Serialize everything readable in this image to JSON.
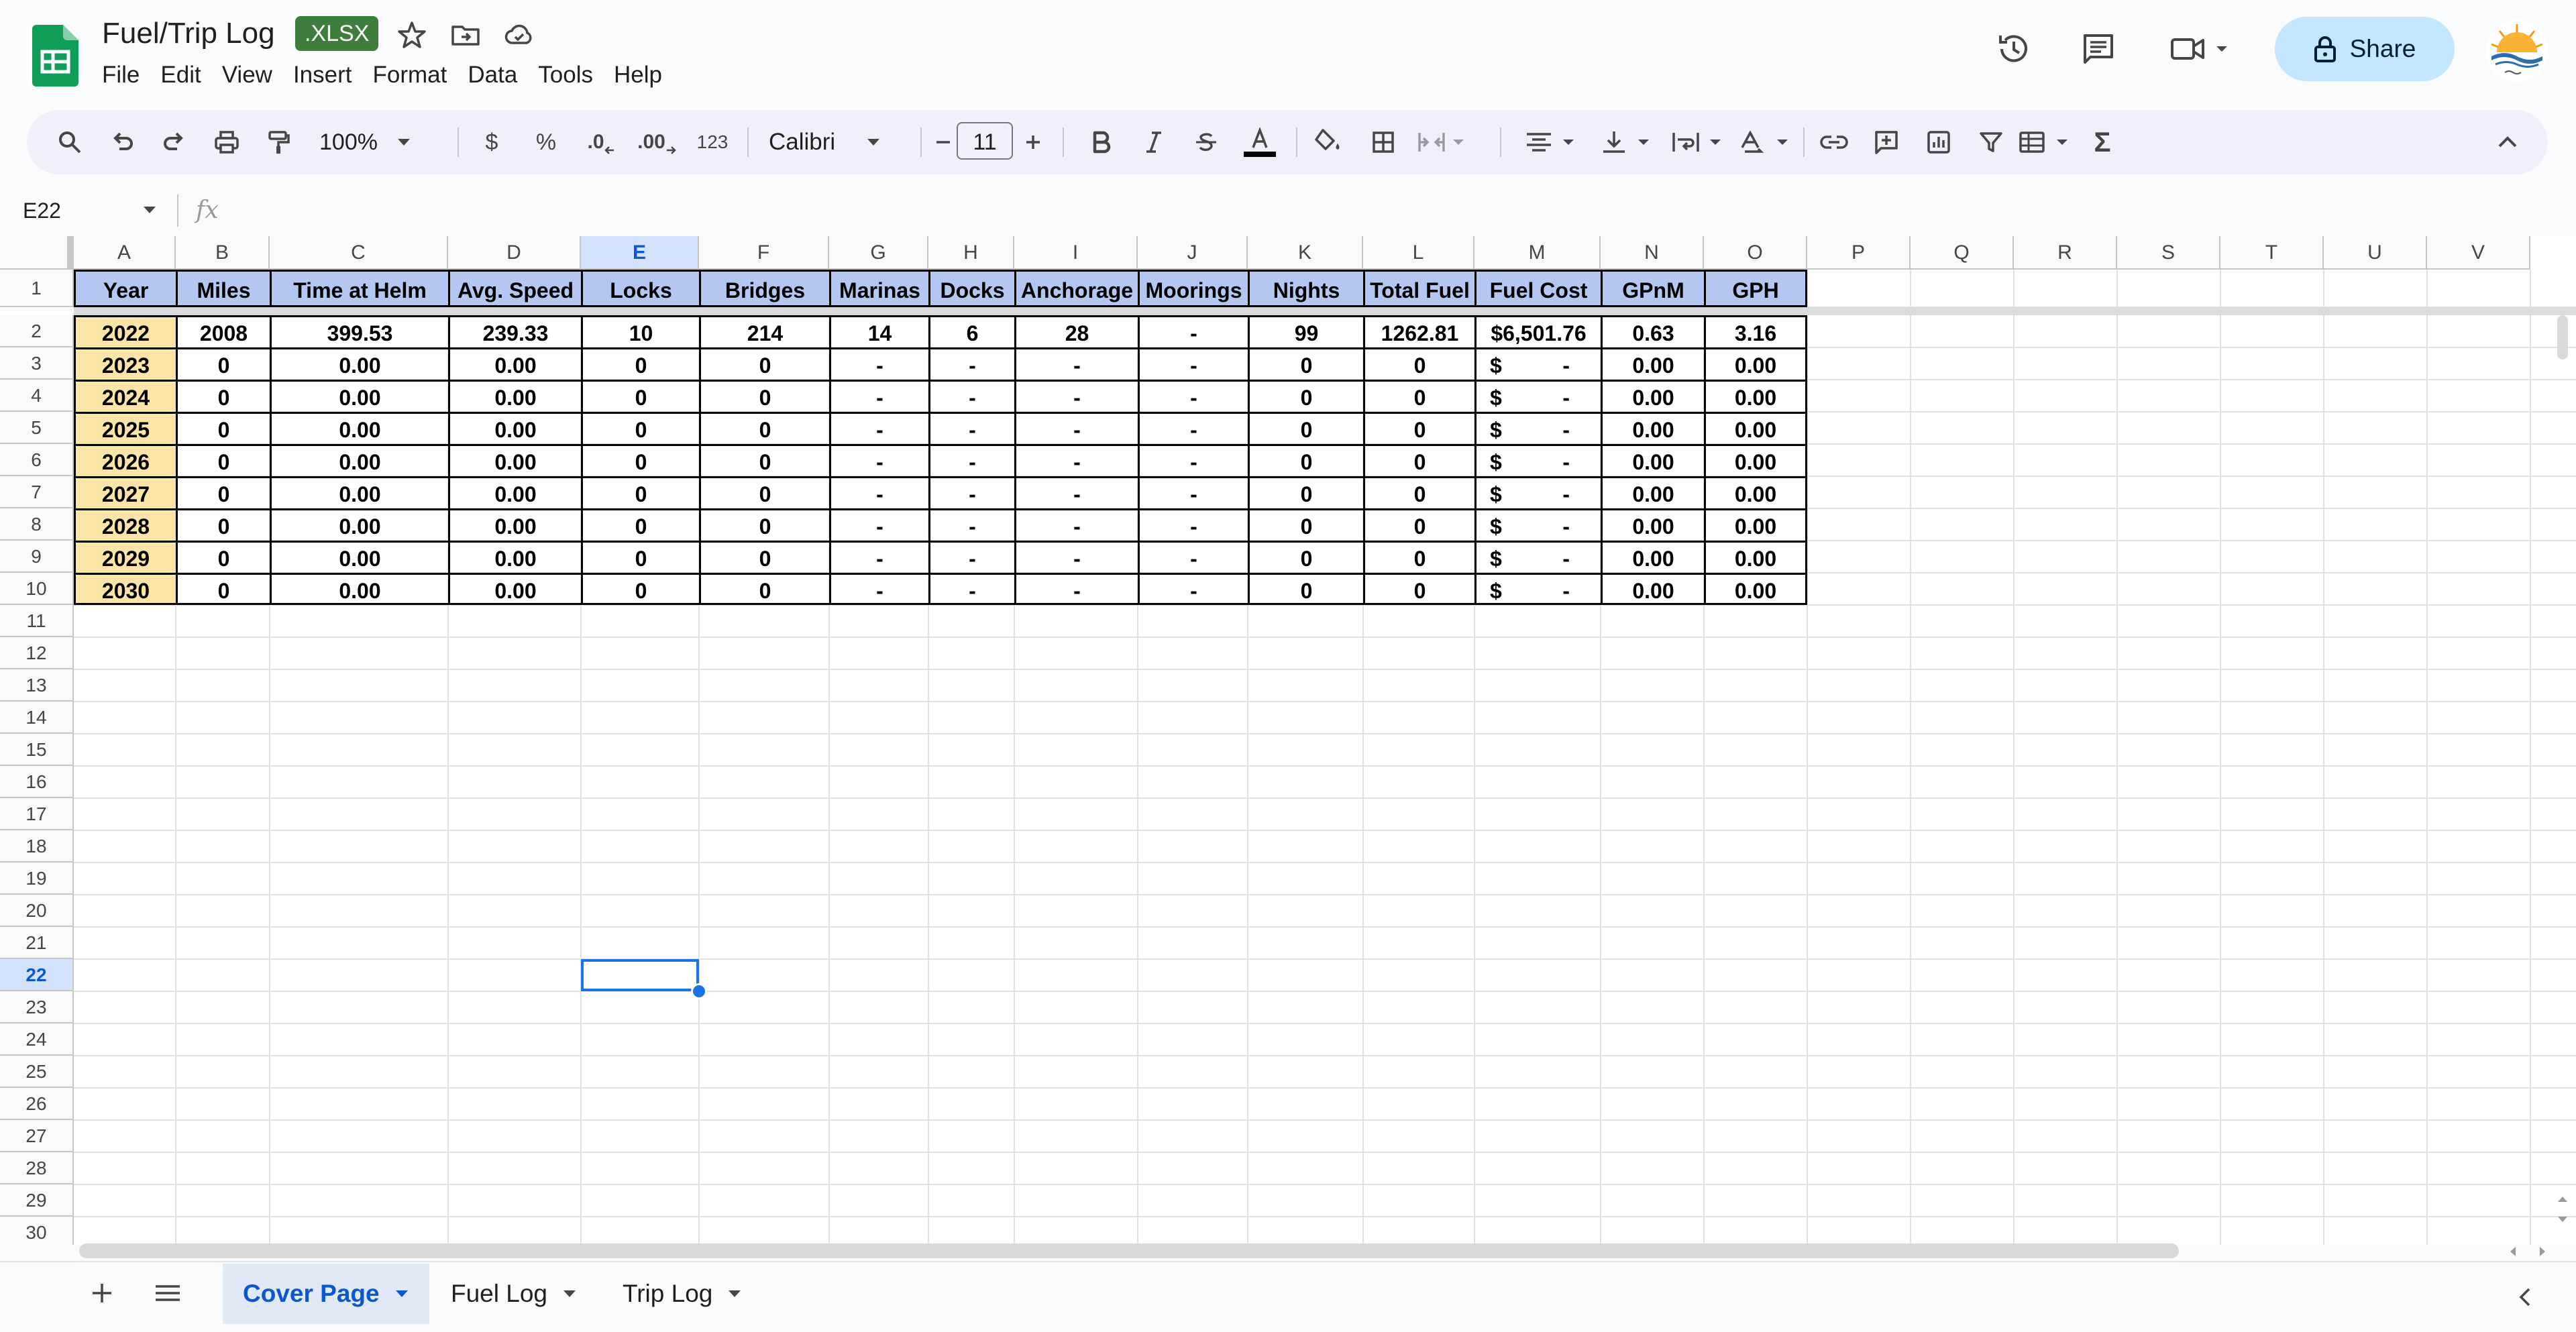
{
  "app": {
    "doc_title": "Fuel/Trip Log",
    "file_badge": ".XLSX",
    "menu": [
      "File",
      "Edit",
      "View",
      "Insert",
      "Format",
      "Data",
      "Tools",
      "Help"
    ],
    "share_label": "Share"
  },
  "toolbar": {
    "zoom": "100%",
    "currency": "$",
    "percent": "%",
    "dec_decrease": ".0",
    "dec_increase": ".00",
    "number_format": "123",
    "font": "Calibri",
    "font_size": "11"
  },
  "formula_bar": {
    "name_box": "E22",
    "fx": "fx"
  },
  "grid": {
    "columns": [
      "A",
      "B",
      "C",
      "D",
      "E",
      "F",
      "G",
      "H",
      "I",
      "J",
      "K",
      "L",
      "M",
      "N",
      "O",
      "P",
      "Q",
      "R",
      "S",
      "T",
      "U",
      "V"
    ],
    "rows": [
      "1",
      "2",
      "3",
      "4",
      "5",
      "6",
      "7",
      "8",
      "9",
      "10",
      "11",
      "12",
      "13",
      "14",
      "15",
      "16",
      "17",
      "18",
      "19",
      "20",
      "21",
      "22",
      "23",
      "24",
      "25",
      "26",
      "27",
      "28",
      "29",
      "30"
    ],
    "selected_column": "E",
    "selected_row": "22",
    "selected_cell": "E22",
    "header_fill": "#b4c7f0",
    "year_fill": "#fbe5a6",
    "headers": [
      "Year",
      "Miles",
      "Time at Helm",
      "Avg. Speed",
      "Locks",
      "Bridges",
      "Marinas",
      "Docks",
      "Anchorage",
      "Moorings",
      "Nights",
      "Total Fuel",
      "Fuel Cost",
      "GPnM",
      "GPH"
    ],
    "data_rows": [
      [
        "2022",
        "2008",
        "399.53",
        "239.33",
        "10",
        "214",
        "14",
        "6",
        "28",
        "-",
        "99",
        "1262.81",
        "$6,501.76",
        "0.63",
        "3.16"
      ],
      [
        "2023",
        "0",
        "0.00",
        "0.00",
        "0",
        "0",
        "-",
        "-",
        "-",
        "-",
        "0",
        "0",
        "$ -",
        "0.00",
        "0.00"
      ],
      [
        "2024",
        "0",
        "0.00",
        "0.00",
        "0",
        "0",
        "-",
        "-",
        "-",
        "-",
        "0",
        "0",
        "$ -",
        "0.00",
        "0.00"
      ],
      [
        "2025",
        "0",
        "0.00",
        "0.00",
        "0",
        "0",
        "-",
        "-",
        "-",
        "-",
        "0",
        "0",
        "$ -",
        "0.00",
        "0.00"
      ],
      [
        "2026",
        "0",
        "0.00",
        "0.00",
        "0",
        "0",
        "-",
        "-",
        "-",
        "-",
        "0",
        "0",
        "$ -",
        "0.00",
        "0.00"
      ],
      [
        "2027",
        "0",
        "0.00",
        "0.00",
        "0",
        "0",
        "-",
        "-",
        "-",
        "-",
        "0",
        "0",
        "$ -",
        "0.00",
        "0.00"
      ],
      [
        "2028",
        "0",
        "0.00",
        "0.00",
        "0",
        "0",
        "-",
        "-",
        "-",
        "-",
        "0",
        "0",
        "$ -",
        "0.00",
        "0.00"
      ],
      [
        "2029",
        "0",
        "0.00",
        "0.00",
        "0",
        "0",
        "-",
        "-",
        "-",
        "-",
        "0",
        "0",
        "$ -",
        "0.00",
        "0.00"
      ],
      [
        "2030",
        "0",
        "0.00",
        "0.00",
        "0",
        "0",
        "-",
        "-",
        "-",
        "-",
        "0",
        "0",
        "$ -",
        "0.00",
        "0.00"
      ]
    ]
  },
  "sheets": [
    {
      "label": "Cover Page",
      "active": true
    },
    {
      "label": "Fuel Log",
      "active": false
    },
    {
      "label": "Trip Log",
      "active": false
    }
  ],
  "icons": {
    "app": "sheets-logo-icon",
    "star": "star-icon",
    "move": "move-to-folder-icon",
    "cloud": "cloud-saved-icon",
    "history": "version-history-icon",
    "comments": "comments-icon",
    "meet": "video-call-icon",
    "lock": "lock-icon"
  }
}
